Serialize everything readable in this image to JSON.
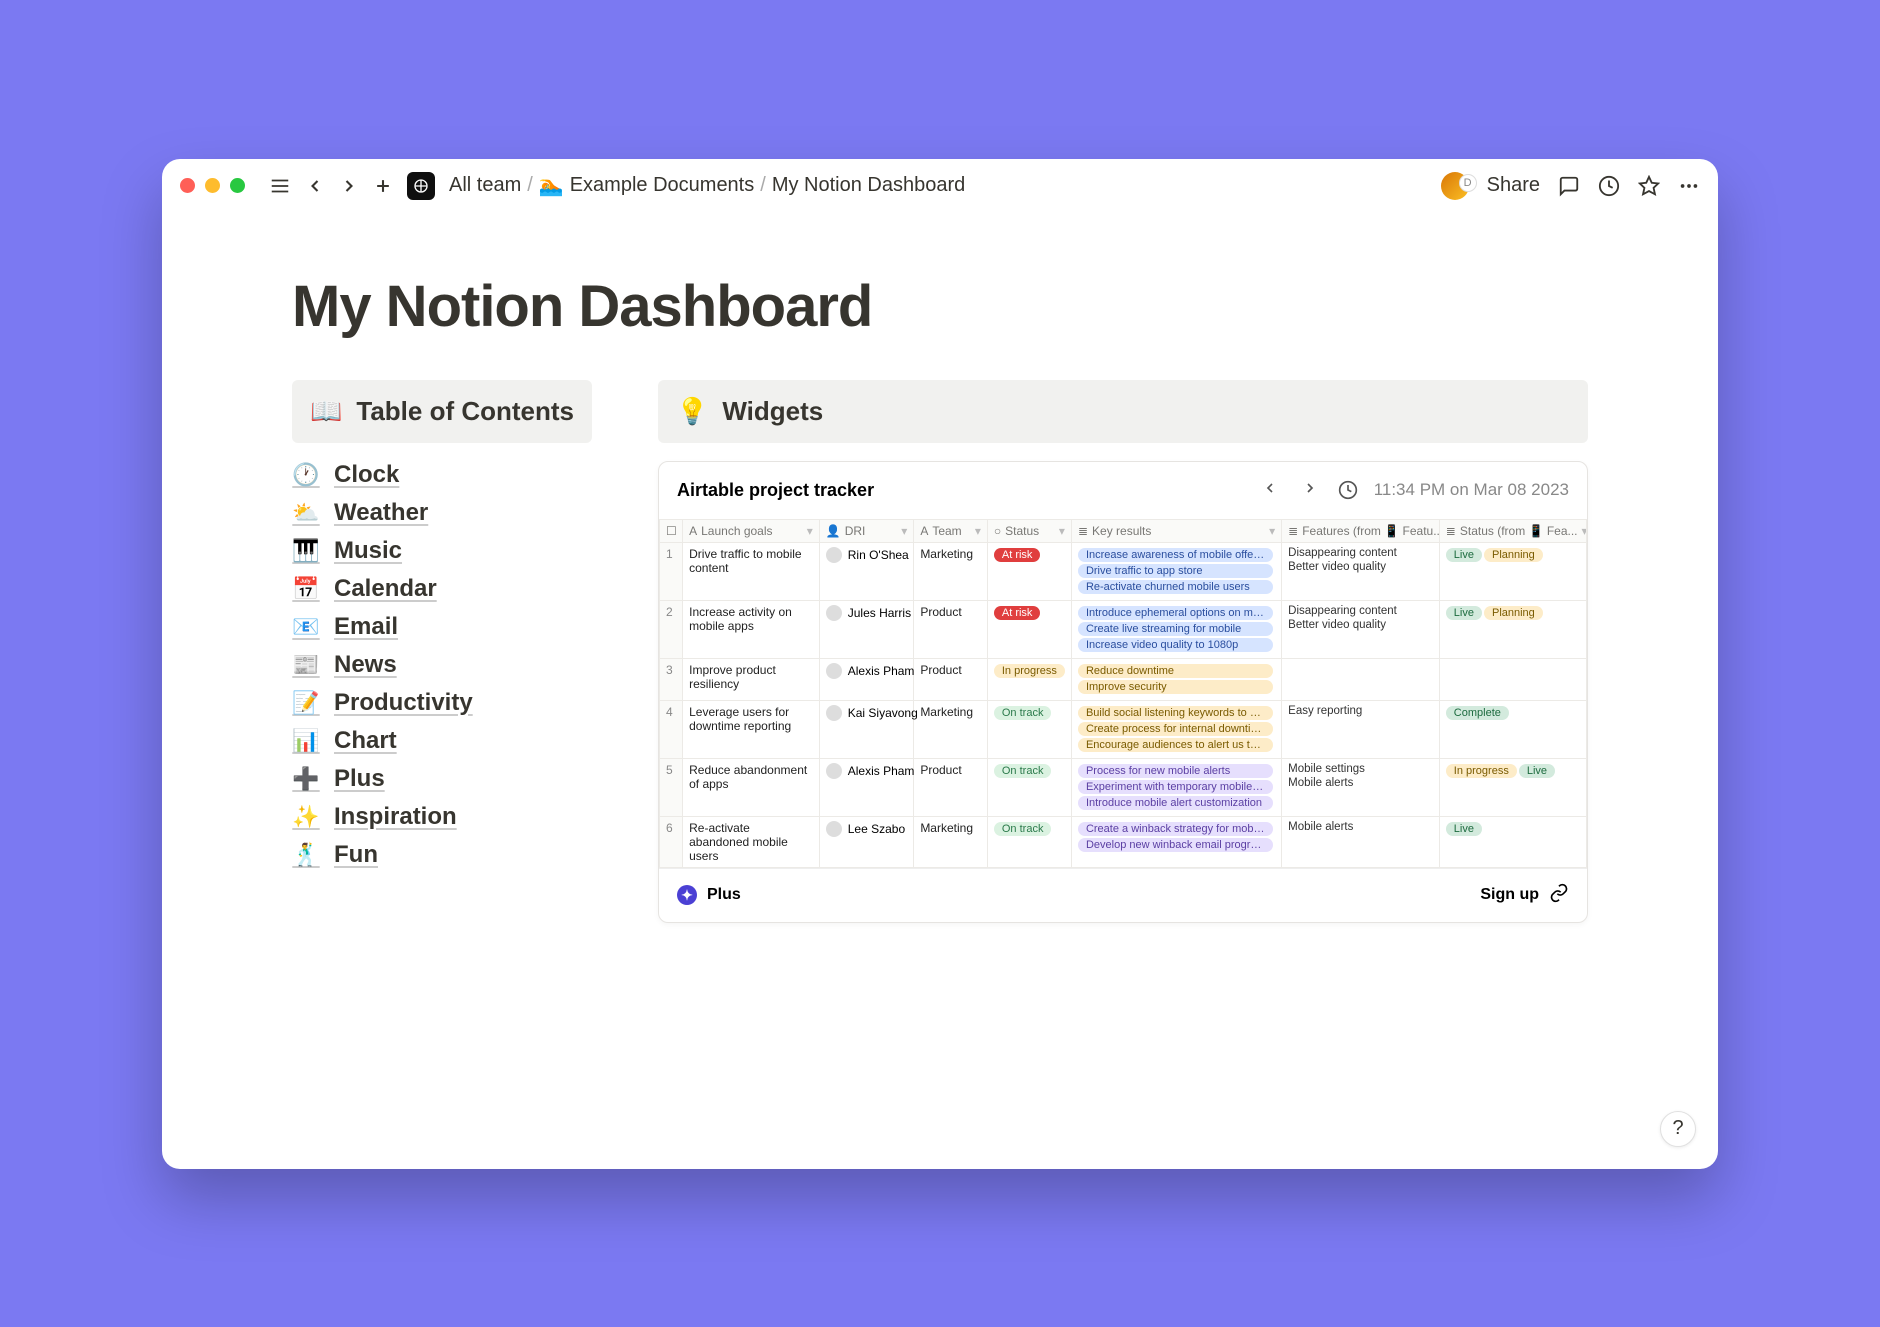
{
  "breadcrumb": {
    "items": [
      {
        "emoji": "",
        "label": "All team"
      },
      {
        "emoji": "🏊",
        "label": "Example Documents"
      },
      {
        "emoji": "",
        "label": "My Notion Dashboard"
      }
    ]
  },
  "toolbar": {
    "share_label": "Share",
    "avatar_letter": "D"
  },
  "page": {
    "title": "My Notion Dashboard"
  },
  "toc": {
    "header_emoji": "📖",
    "header_label": "Table of Contents",
    "items": [
      {
        "emoji": "🕐",
        "label": "Clock"
      },
      {
        "emoji": "⛅",
        "label": "Weather"
      },
      {
        "emoji": "🎹",
        "label": "Music"
      },
      {
        "emoji": "📅",
        "label": "Calendar"
      },
      {
        "emoji": "📧",
        "label": "Email"
      },
      {
        "emoji": "📰",
        "label": "News"
      },
      {
        "emoji": "📝",
        "label": "Productivity"
      },
      {
        "emoji": "📊",
        "label": "Chart"
      },
      {
        "emoji": "➕",
        "label": "Plus"
      },
      {
        "emoji": "✨",
        "label": "Inspiration"
      },
      {
        "emoji": "🕺",
        "label": "Fun"
      }
    ]
  },
  "widgets": {
    "header_emoji": "💡",
    "header_label": "Widgets",
    "airtable": {
      "title": "Airtable project tracker",
      "timestamp": "11:34 PM on Mar 08 2023",
      "columns": [
        "Launch goals",
        "DRI",
        "Team",
        "Status",
        "Key results",
        "Features (from 📱 Featu...",
        "Status (from 📱 Fea..."
      ],
      "rows": [
        {
          "num": "1",
          "goal": "Drive traffic to mobile content",
          "dri": "Rin O'Shea",
          "team": "Marketing",
          "status": {
            "text": "At risk",
            "color": "red-solid"
          },
          "key_results": [
            {
              "text": "Increase awareness of mobile offerings",
              "color": "blue"
            },
            {
              "text": "Drive traffic to app store",
              "color": "blue"
            },
            {
              "text": "Re-activate churned mobile users",
              "color": "blue"
            }
          ],
          "features": [
            "Disappearing content",
            "Better video quality"
          ],
          "status2": [
            {
              "text": "Live",
              "color": "green"
            },
            {
              "text": "Planning",
              "color": "yellow"
            }
          ]
        },
        {
          "num": "2",
          "goal": "Increase activity on mobile apps",
          "dri": "Jules Harris",
          "team": "Product",
          "status": {
            "text": "At risk",
            "color": "red-solid"
          },
          "key_results": [
            {
              "text": "Introduce ephemeral options on mobile",
              "color": "blue"
            },
            {
              "text": "Create live streaming for mobile",
              "color": "blue"
            },
            {
              "text": "Increase video quality to 1080p",
              "color": "blue"
            }
          ],
          "features": [
            "Disappearing content",
            "Better video quality"
          ],
          "status2": [
            {
              "text": "Live",
              "color": "green"
            },
            {
              "text": "Planning",
              "color": "yellow"
            }
          ]
        },
        {
          "num": "3",
          "goal": "Improve product resiliency",
          "dri": "Alexis Pham",
          "team": "Product",
          "status": {
            "text": "In progress",
            "color": "yellow"
          },
          "key_results": [
            {
              "text": "Reduce downtime",
              "color": "yellow"
            },
            {
              "text": "Improve security",
              "color": "yellow"
            }
          ],
          "features": [],
          "status2": []
        },
        {
          "num": "4",
          "goal": "Leverage users for downtime reporting",
          "dri": "Kai Siyavong",
          "team": "Marketing",
          "status": {
            "text": "On track",
            "color": "lightgreen"
          },
          "key_results": [
            {
              "text": "Build social listening keywords to cat...",
              "color": "yellow"
            },
            {
              "text": "Create process for internal downtime ...",
              "color": "yellow"
            },
            {
              "text": "Encourage audiences to alert us to is...",
              "color": "yellow"
            }
          ],
          "features": [
            "Easy reporting"
          ],
          "status2": [
            {
              "text": "Complete",
              "color": "green"
            }
          ]
        },
        {
          "num": "5",
          "goal": "Reduce abandonment of apps",
          "dri": "Alexis Pham",
          "team": "Product",
          "status": {
            "text": "On track",
            "color": "lightgreen"
          },
          "key_results": [
            {
              "text": "Process for new mobile alerts",
              "color": "purple"
            },
            {
              "text": "Experiment with temporary mobile mute",
              "color": "purple"
            },
            {
              "text": "Introduce mobile alert customization",
              "color": "purple"
            }
          ],
          "features": [
            "Mobile settings",
            "Mobile alerts"
          ],
          "status2": [
            {
              "text": "In progress",
              "color": "yellow"
            },
            {
              "text": "Live",
              "color": "green"
            }
          ]
        },
        {
          "num": "6",
          "goal": "Re-activate abandoned mobile users",
          "dri": "Lee Szabo",
          "team": "Marketing",
          "status": {
            "text": "On track",
            "color": "lightgreen"
          },
          "key_results": [
            {
              "text": "Create a winback strategy for mobile ...",
              "color": "purple"
            },
            {
              "text": "Develop new winback email program",
              "color": "purple"
            }
          ],
          "features": [
            "Mobile alerts"
          ],
          "status2": [
            {
              "text": "Live",
              "color": "green"
            }
          ]
        }
      ],
      "footer": {
        "plus_label": "Plus",
        "signup_label": "Sign up"
      }
    }
  }
}
